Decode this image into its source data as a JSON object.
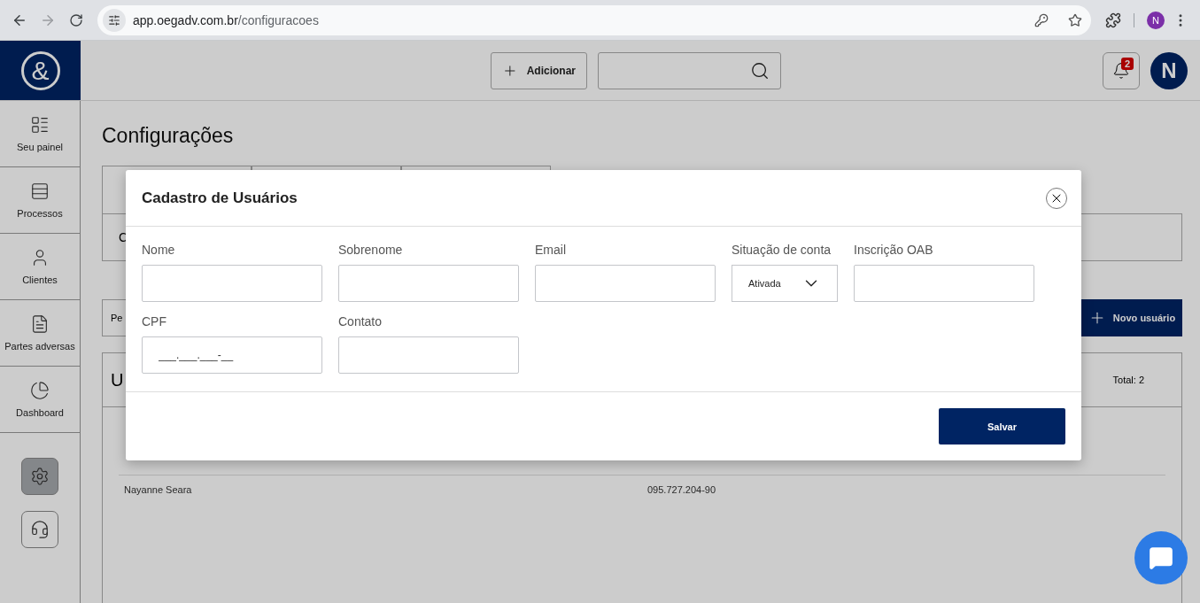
{
  "browser": {
    "url_host": "app.oegadv.com.br",
    "url_path": "/configuracoes",
    "profile_initial": "N"
  },
  "header": {
    "logo_text": "&",
    "add_button": "Adicionar",
    "notifications": "2",
    "avatar": "N"
  },
  "sidebar": {
    "items": [
      {
        "label": "Seu painel",
        "kind": "panel",
        "selected": false
      },
      {
        "label": "Processos",
        "kind": "processes",
        "selected": false
      },
      {
        "label": "Clientes",
        "kind": "clients",
        "selected": false
      },
      {
        "label": "Partes adversas",
        "kind": "parties",
        "selected": false
      },
      {
        "label": "Dashboard",
        "kind": "dashboard",
        "selected": false
      }
    ],
    "tools": [
      {
        "kind": "settings",
        "selected": true
      },
      {
        "kind": "support",
        "selected": false
      }
    ]
  },
  "page": {
    "title": "Configurações",
    "card_fragment": "C",
    "filter_fragment": "Pe",
    "new_user_button": "Novo usuário",
    "users_title_fragment": "U",
    "total": "Total: 2",
    "rows": [
      {
        "name": "Nayanne Seara",
        "cpf": "095.727.204-90"
      }
    ]
  },
  "modal": {
    "title": "Cadastro de Usuários",
    "fields": [
      {
        "label": "Nome",
        "kind": "text"
      },
      {
        "label": "Sobrenome",
        "kind": "text"
      },
      {
        "label": "Email",
        "kind": "text"
      },
      {
        "label": "Situação de conta",
        "kind": "select",
        "value": "Ativada"
      },
      {
        "label": "Inscrição OAB",
        "kind": "text"
      },
      {
        "label": "CPF",
        "kind": "text",
        "placeholder": "___.___.___-__"
      },
      {
        "label": "Contato",
        "kind": "text"
      }
    ],
    "save_button": "Salvar"
  }
}
